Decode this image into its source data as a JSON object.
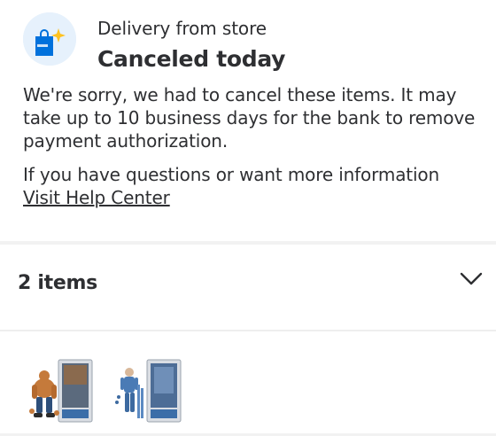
{
  "order": {
    "subtitle": "Delivery from store",
    "status": "Canceled today",
    "message": "We're sorry, we had to cancel these items. It may take up to 10 business days for the bank to remove payment authorization.",
    "question": "If you have questions or want more information",
    "help_link": "Visit Help Center"
  },
  "items": {
    "count_label": "2 items",
    "toggle_icon": "chevron-down-icon",
    "thumbnails": [
      {
        "icon": "action-figure-orange-product"
      },
      {
        "icon": "action-figure-blue-product"
      }
    ]
  },
  "colors": {
    "text": "#2e2f32",
    "bag_bg": "#e6f1fc",
    "bag_blue": "#0071dc",
    "spark_yellow": "#ffc220",
    "divider": "#f2f2f2"
  }
}
